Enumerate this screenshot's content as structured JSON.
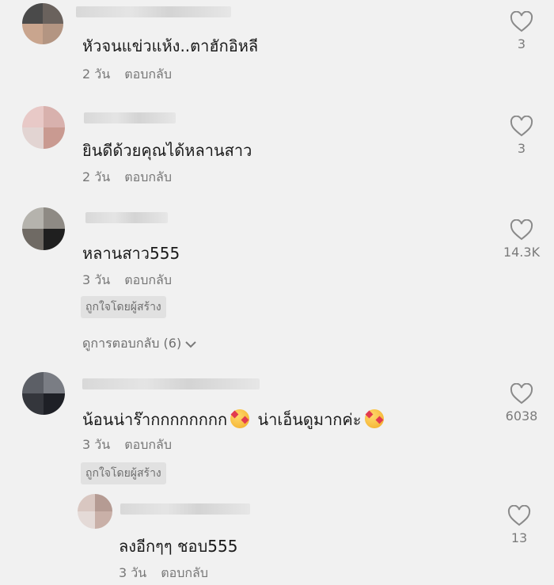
{
  "comments": [
    {
      "text": "หัวจนแข่วแห้ง..ตาฮักอิหลี",
      "age": "2 วัน",
      "reply_label": "ตอบกลับ",
      "likes": "3"
    },
    {
      "text": "ยินดีด้วยคุณได้หลานสาว",
      "age": "2 วัน",
      "reply_label": "ตอบกลับ",
      "likes": "3"
    },
    {
      "text": "หลานสาว555",
      "age": "3 วัน",
      "reply_label": "ตอบกลับ",
      "likes": "14.3K",
      "badge": "ถูกใจโดยผู้สร้าง"
    },
    {
      "text_a": "น้อนน่าร๊ากกกกกกกก",
      "text_b": "น่าเอ็นดูมากค่ะ",
      "age": "3 วัน",
      "reply_label": "ตอบกลับ",
      "likes": "6038",
      "badge": "ถูกใจโดยผู้สร้าง"
    }
  ],
  "view_replies": "ดูการตอบกลับ (6)",
  "reply": {
    "text": "ลงอีกๆๆ ชอบ555",
    "age": "3 วัน",
    "reply_label": "ตอบกลับ",
    "likes": "13"
  },
  "icons": {
    "like": "heart-outline-icon",
    "expand": "chevron-down-icon",
    "emoji": "smiling-face-with-hearts-emoji"
  },
  "colors": {
    "background": "#f1f1f1",
    "text": "#1a1a1a",
    "meta": "#777777"
  }
}
